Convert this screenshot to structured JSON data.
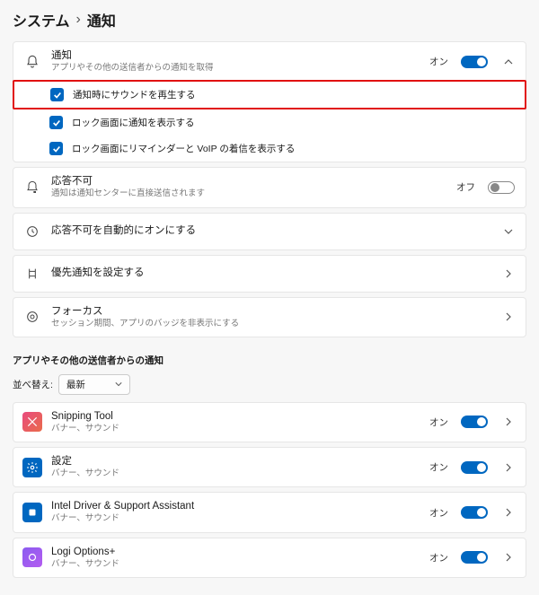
{
  "breadcrumb": {
    "parent": "システム",
    "current": "通知"
  },
  "notifications_card": {
    "title": "通知",
    "subtitle": "アプリやその他の送信者からの通知を取得",
    "state_label": "オン",
    "options": {
      "sound": "通知時にサウンドを再生する",
      "lockscreen": "ロック画面に通知を表示する",
      "lockscreen_voip": "ロック画面にリマインダーと VoIP の着信を表示する"
    }
  },
  "dnd": {
    "title": "応答不可",
    "subtitle": "通知は通知センターに直接送信されます",
    "state_label": "オフ"
  },
  "dnd_auto": {
    "title": "応答不可を自動的にオンにする"
  },
  "priority": {
    "title": "優先通知を設定する"
  },
  "focus": {
    "title": "フォーカス",
    "subtitle": "セッション期間、アプリのバッジを非表示にする"
  },
  "apps_section": {
    "header": "アプリやその他の送信者からの通知",
    "sort_label": "並べ替え:",
    "sort_value": "最新"
  },
  "apps": [
    {
      "name": "Snipping Tool",
      "sub": "バナー、サウンド",
      "state": "オン",
      "icon": "snip"
    },
    {
      "name": "設定",
      "sub": "バナー、サウンド",
      "state": "オン",
      "icon": "settings"
    },
    {
      "name": "Intel Driver & Support Assistant",
      "sub": "バナー、サウンド",
      "state": "オン",
      "icon": "intel"
    },
    {
      "name": "Logi Options+",
      "sub": "バナー、サウンド",
      "state": "オン",
      "icon": "logi"
    }
  ]
}
